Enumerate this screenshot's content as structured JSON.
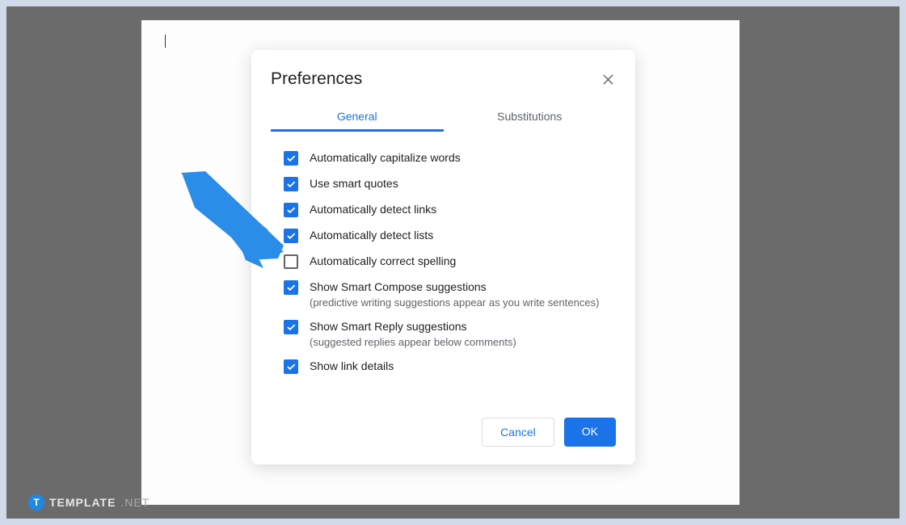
{
  "dialog": {
    "title": "Preferences",
    "tabs": {
      "general": "General",
      "substitutions": "Substitutions"
    },
    "options": [
      {
        "label": "Automatically capitalize words",
        "checked": true
      },
      {
        "label": "Use smart quotes",
        "checked": true
      },
      {
        "label": "Automatically detect links",
        "checked": true
      },
      {
        "label": "Automatically detect lists",
        "checked": true
      },
      {
        "label": "Automatically correct spelling",
        "checked": false
      },
      {
        "label": "Show Smart Compose suggestions",
        "desc": "(predictive writing suggestions appear as you write sentences)",
        "checked": true
      },
      {
        "label": "Show Smart Reply suggestions",
        "desc": "(suggested replies appear below comments)",
        "checked": true
      },
      {
        "label": "Show link details",
        "checked": true
      }
    ],
    "buttons": {
      "cancel": "Cancel",
      "ok": "OK"
    }
  },
  "watermark": {
    "icon": "T",
    "brand": "TEMPLATE",
    "suffix": ".NET"
  }
}
